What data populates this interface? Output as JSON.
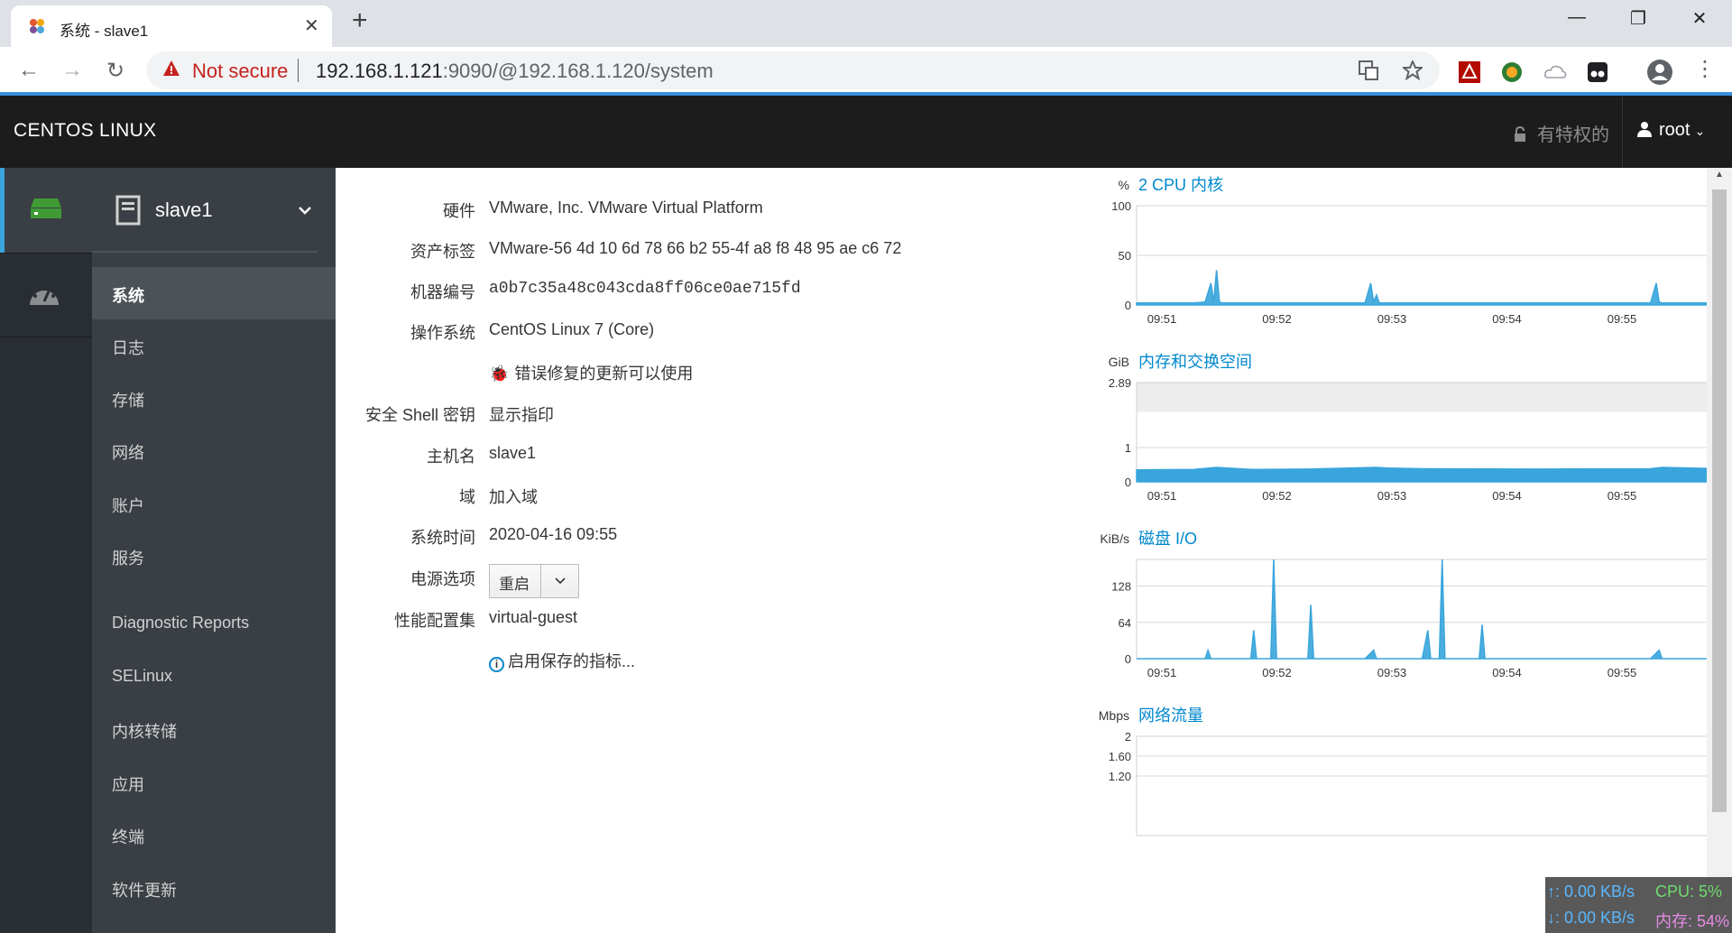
{
  "browser": {
    "tab_title": "系统 - slave1",
    "security_label": "Not secure",
    "url_host": "192.168.1.121",
    "url_rest": ":9090/@192.168.1.120/system"
  },
  "header": {
    "brand": "CENTOS LINUX",
    "privileged": "有特权的",
    "user": "root"
  },
  "host_selector": {
    "name": "slave1"
  },
  "nav": {
    "items": [
      {
        "label": "系统",
        "active": true
      },
      {
        "label": "日志"
      },
      {
        "label": "存储"
      },
      {
        "label": "网络"
      },
      {
        "label": "账户"
      },
      {
        "label": "服务"
      },
      {
        "label": "Diagnostic Reports"
      },
      {
        "label": "SELinux"
      },
      {
        "label": "内核转储"
      },
      {
        "label": "应用"
      },
      {
        "label": "终端"
      },
      {
        "label": "软件更新"
      }
    ]
  },
  "system": {
    "hardware_label": "硬件",
    "hardware_value": "VMware, Inc. VMware Virtual Platform",
    "asset_label": "资产标签",
    "asset_value": "VMware-56 4d 10 6d 78 66 b2 55-4f a8 f8 48 95 ae c6 72",
    "machine_id_label": "机器编号",
    "machine_id_value": "a0b7c35a48c043cda8ff06ce0ae715fd",
    "os_label": "操作系统",
    "os_value": "CentOS Linux 7 (Core)",
    "updates_link": "错误修复的更新可以使用",
    "ssh_label": "安全 Shell 密钥",
    "ssh_value": "显示指印",
    "hostname_label": "主机名",
    "hostname_value": "slave1",
    "domain_label": "域",
    "domain_value": "加入域",
    "time_label": "系统时间",
    "time_value": "2020-04-16 09:55",
    "power_label": "电源选项",
    "power_button": "重启",
    "profile_label": "性能配置集",
    "profile_value": "virtual-guest",
    "metrics_link": "启用保存的指标..."
  },
  "chart_data": [
    {
      "type": "area",
      "unit": "%",
      "title": "2 CPU 内核",
      "ylim": [
        0,
        100
      ],
      "yticks": [
        "100",
        "50",
        "0"
      ],
      "ytick_values": [
        100,
        50,
        0
      ],
      "xticks": [
        "09:51",
        "09:52",
        "09:53",
        "09:54",
        "09:55"
      ],
      "x": [
        0,
        0.1,
        0.12,
        0.13,
        0.135,
        0.14,
        0.145,
        0.15,
        0.16,
        0.2,
        0.3,
        0.4,
        0.41,
        0.415,
        0.42,
        0.425,
        0.43,
        0.44,
        0.5,
        0.6,
        0.7,
        0.8,
        0.9,
        0.91,
        0.915,
        0.92,
        0.93,
        1
      ],
      "values": [
        2,
        2,
        3,
        22,
        3,
        35,
        3,
        2,
        2,
        2,
        2,
        2,
        22,
        3,
        10,
        2,
        2,
        2,
        2,
        2,
        2,
        2,
        2,
        22,
        3,
        2,
        2,
        2
      ]
    },
    {
      "type": "area",
      "unit": "GiB",
      "title": "内存和交换空间",
      "ylim": [
        0,
        2.89
      ],
      "yticks": [
        "2.89",
        "1",
        "0"
      ],
      "ytick_values": [
        2.89,
        1,
        0
      ],
      "xticks": [
        "09:51",
        "09:52",
        "09:53",
        "09:54",
        "09:55"
      ],
      "x": [
        0,
        0.1,
        0.14,
        0.2,
        0.3,
        0.42,
        0.44,
        0.5,
        0.7,
        0.9,
        0.92,
        1
      ],
      "values": [
        0.35,
        0.36,
        0.42,
        0.36,
        0.37,
        0.42,
        0.4,
        0.38,
        0.37,
        0.38,
        0.42,
        0.39
      ]
    },
    {
      "type": "area",
      "unit": "KiB/s",
      "title": "磁盘 I/O",
      "ylim": [
        0,
        175
      ],
      "yticks": [
        "128",
        "64",
        "0"
      ],
      "ytick_values": [
        128,
        64,
        0
      ],
      "xticks": [
        "09:51",
        "09:52",
        "09:53",
        "09:54",
        "09:55"
      ],
      "x": [
        0,
        0.12,
        0.125,
        0.13,
        0.2,
        0.205,
        0.21,
        0.235,
        0.24,
        0.245,
        0.3,
        0.305,
        0.31,
        0.4,
        0.415,
        0.42,
        0.43,
        0.5,
        0.51,
        0.515,
        0.53,
        0.535,
        0.54,
        0.6,
        0.605,
        0.61,
        0.9,
        0.915,
        0.92,
        1
      ],
      "values": [
        0,
        0,
        15,
        0,
        0,
        50,
        0,
        0,
        175,
        0,
        0,
        95,
        0,
        0,
        15,
        0,
        0,
        0,
        50,
        0,
        0,
        175,
        0,
        0,
        60,
        0,
        0,
        15,
        0,
        0
      ]
    },
    {
      "type": "area",
      "unit": "Mbps",
      "title": "网络流量",
      "ylim": [
        0,
        2
      ],
      "yticks": [
        "2",
        "1.60",
        "1.20"
      ],
      "ytick_values": [
        2,
        1.6,
        1.2
      ],
      "xticks": [],
      "x": [],
      "values": []
    }
  ],
  "netmon": {
    "up": "↑: 0.00 KB/s",
    "down": "↓: 0.00 KB/s",
    "cpu": "CPU: 5%",
    "mem": "内存: 54%"
  },
  "colors": {
    "accent": "#0088ce",
    "chart_fill": "#39a5dc",
    "header_bg": "#1c1c1c",
    "nav_bg": "#393f44",
    "rail_bg": "#292e34"
  }
}
